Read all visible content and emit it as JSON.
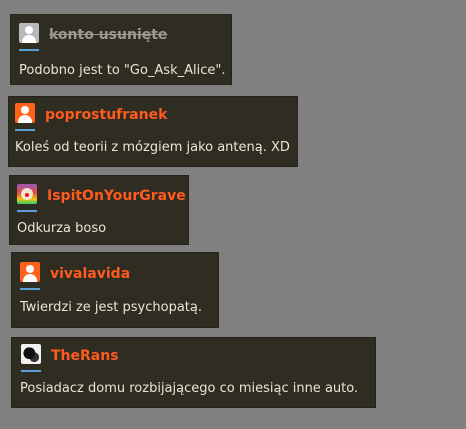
{
  "comments": [
    {
      "username": "konto usunięte",
      "deleted": true,
      "avatar": "gray-user-icon",
      "text": "Podobno jest to \"Go_Ask_Alice\"."
    },
    {
      "username": "poprostufranek",
      "deleted": false,
      "avatar": "orange-user-icon",
      "text": "Koleś od teorii z mózgiem jako anteną. XD"
    },
    {
      "username": "IspitOnYourGrave",
      "deleted": false,
      "avatar": "clown-avatar",
      "text": "Odkurza boso"
    },
    {
      "username": "vivalavida",
      "deleted": false,
      "avatar": "orange-user-icon",
      "text": "Twierdzi ze jest psychopatą."
    },
    {
      "username": "TheRans",
      "deleted": false,
      "avatar": "black-white-avatar",
      "text": "Posiadacz domu rozbijającego co miesiąc inne auto."
    }
  ],
  "colors": {
    "page_background": "#808080",
    "card_background": "#2f2c22",
    "username": "#ff5a1f",
    "deleted_username": "#9a9a92",
    "body_text": "#e9e6d4",
    "avatar_underline": "#5a9fd6"
  }
}
